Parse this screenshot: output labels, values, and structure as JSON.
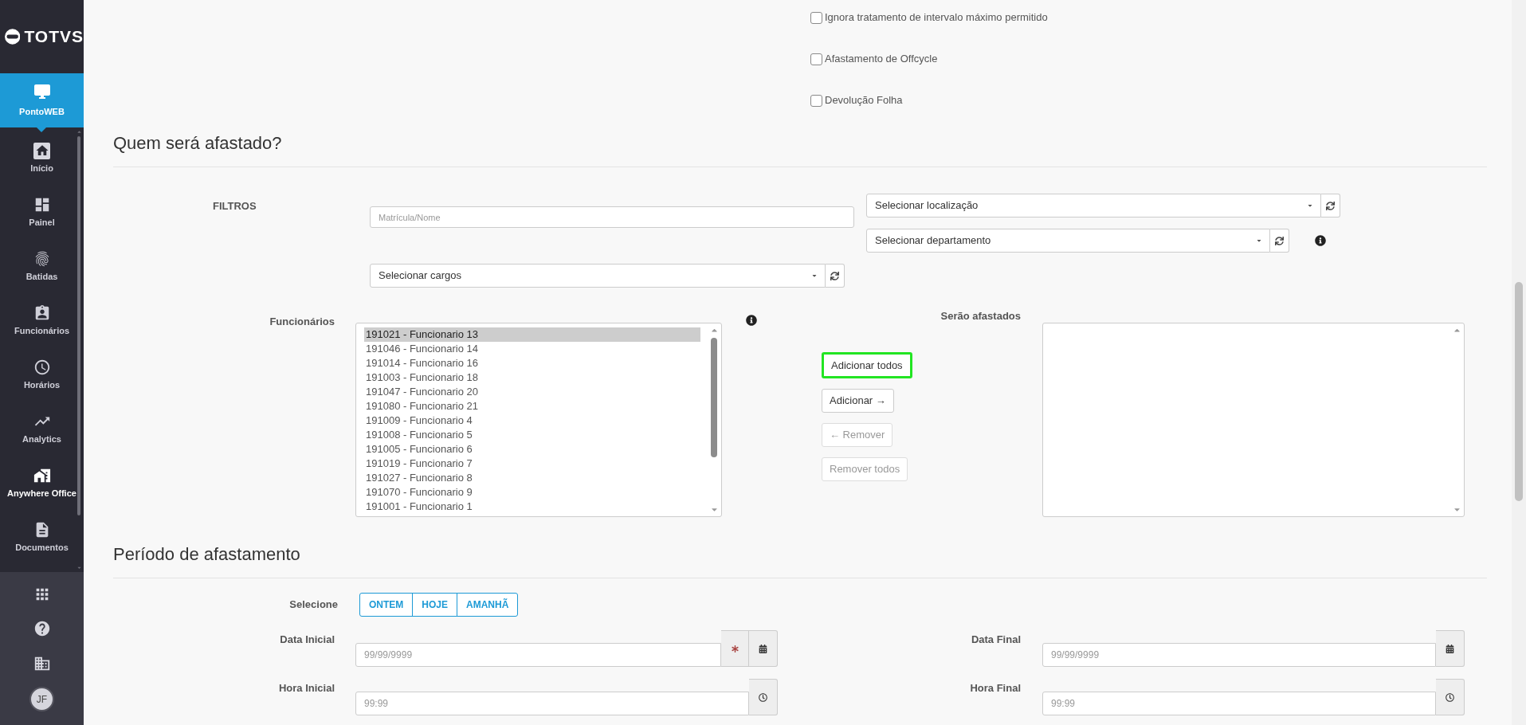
{
  "sidebar": {
    "logo": "TOTVS",
    "module": {
      "label": "PontoWEB",
      "selected": true
    },
    "items": [
      {
        "label": "Início",
        "selected": false,
        "highlighted": false
      },
      {
        "label": "Painel",
        "selected": false,
        "highlighted": false
      },
      {
        "label": "Batidas",
        "selected": false,
        "highlighted": false
      },
      {
        "label": "Funcionários",
        "selected": false,
        "highlighted": false
      },
      {
        "label": "Horários",
        "selected": false,
        "highlighted": false
      },
      {
        "label": "Analytics",
        "selected": false,
        "highlighted": false
      },
      {
        "label": "Anywhere Office",
        "selected": false,
        "highlighted": true
      },
      {
        "label": "Documentos",
        "selected": false,
        "highlighted": false
      }
    ],
    "avatar": {
      "initials": "JF"
    }
  },
  "options": [
    {
      "label": "Ignora tratamento de intervalo máximo permitido",
      "checked": false
    },
    {
      "label": "Afastamento de Offcycle",
      "checked": false
    },
    {
      "label": "Devolução Folha",
      "checked": false
    }
  ],
  "who_section": {
    "title": "Quem será afastado?",
    "filters": {
      "label": "FILTROS",
      "search": {
        "placeholder": "Matrícula/Nome"
      },
      "location": {
        "value": "Selecionar localização"
      },
      "department": {
        "value": "Selecionar departamento"
      },
      "positions": {
        "value": "Selecionar cargos"
      }
    },
    "employees": {
      "label": "Funcionários",
      "items": [
        {
          "text": "191021 - Funcionario 13",
          "selected": true
        },
        {
          "text": "191046 - Funcionario 14",
          "selected": false
        },
        {
          "text": "191014 - Funcionario 16",
          "selected": false
        },
        {
          "text": "191003 - Funcionario 18",
          "selected": false
        },
        {
          "text": "191047 - Funcionario 20",
          "selected": false
        },
        {
          "text": "191080 - Funcionario 21",
          "selected": false
        },
        {
          "text": "191009 - Funcionario 4",
          "selected": false
        },
        {
          "text": "191008 - Funcionario 5",
          "selected": false
        },
        {
          "text": "191005 - Funcionario 6",
          "selected": false
        },
        {
          "text": "191019 - Funcionario 7",
          "selected": false
        },
        {
          "text": "191027 - Funcionario 8",
          "selected": false
        },
        {
          "text": "191070 - Funcionario 9",
          "selected": false
        },
        {
          "text": "191001 - Funcionario 1",
          "selected": false
        }
      ]
    },
    "actions": [
      {
        "label": "Adicionar todos",
        "focused": true,
        "disabled": false
      },
      {
        "label": "Adicionar →",
        "focused": false,
        "disabled": false
      },
      {
        "label": "← Remover",
        "focused": false,
        "disabled": true
      },
      {
        "label": "Remover todos",
        "focused": false,
        "disabled": true
      }
    ],
    "chosen": {
      "label": "Serão afastados"
    }
  },
  "period_section": {
    "title": "Período de afastamento",
    "quick_select": {
      "label": "Selecione",
      "options": [
        {
          "label": "ONTEM",
          "selected": false
        },
        {
          "label": "HOJE",
          "selected": false
        },
        {
          "label": "AMANHÃ",
          "selected": false
        }
      ]
    },
    "fields": [
      {
        "label": "Data Inicial",
        "placeholder": "99/99/9999",
        "kind": "date",
        "required": true
      },
      {
        "label": "Data Final",
        "placeholder": "99/99/9999",
        "kind": "date",
        "required": false
      },
      {
        "label": "Hora Inicial",
        "placeholder": "99:99",
        "kind": "time",
        "required": false
      },
      {
        "label": "Hora Final",
        "placeholder": "99:99",
        "kind": "time",
        "required": false
      }
    ]
  }
}
